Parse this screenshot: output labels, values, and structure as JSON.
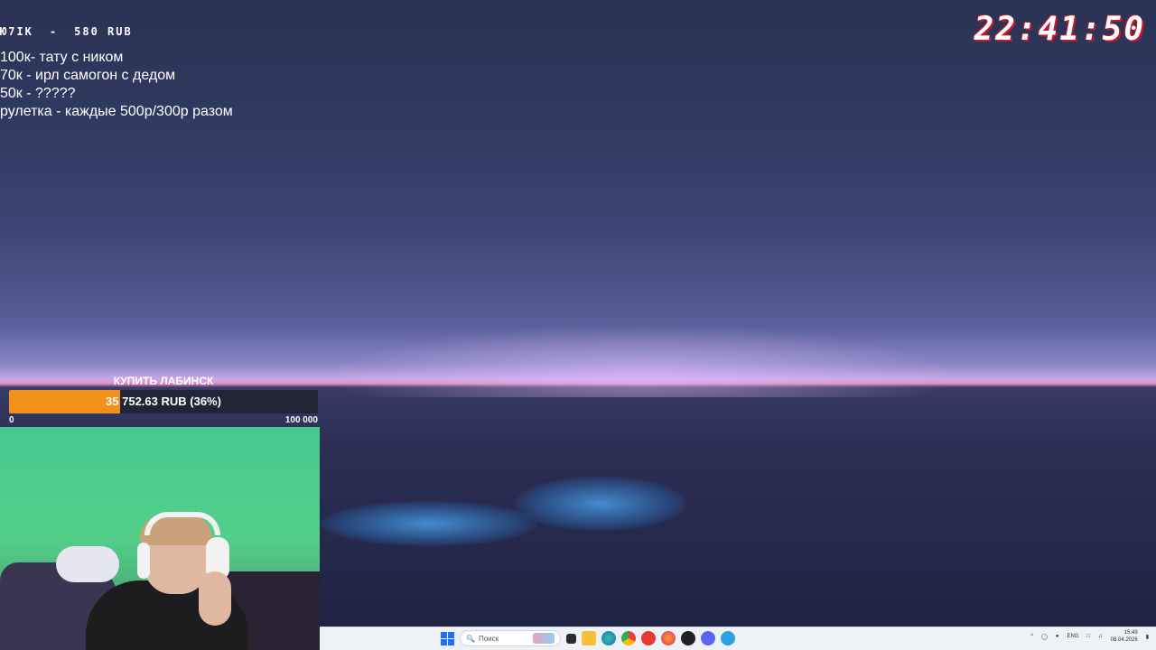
{
  "overlay": {
    "last_donation": {
      "name": "Ю7IK",
      "separator": "-",
      "amount": "580 RUB"
    },
    "goals": [
      "100к- тату с ником",
      "70к - ирл самогон с дедом",
      "50к - ?????",
      "рулетка - каждые 500р/300р разом"
    ],
    "clock": "22:41:50"
  },
  "donation_goal": {
    "title": "КУПИТЬ ЛАБИНСК",
    "progress_text": "35 752.63 RUB (36%)",
    "progress_fraction": 0.36,
    "min_label": "0",
    "max_label": "100 000",
    "fill_color": "#f39019"
  },
  "taskbar": {
    "search_placeholder": "Поиск",
    "language": "ENG",
    "time": "15:49",
    "date": "08.04.2026",
    "apps": [
      "windows-start-icon",
      "search",
      "widgets-icon",
      "task-view-icon",
      "file-explorer-icon",
      "edge-icon",
      "chrome-icon",
      "yandex-icon",
      "firefox-icon",
      "obs-icon",
      "discord-icon",
      "telegram-icon"
    ]
  }
}
